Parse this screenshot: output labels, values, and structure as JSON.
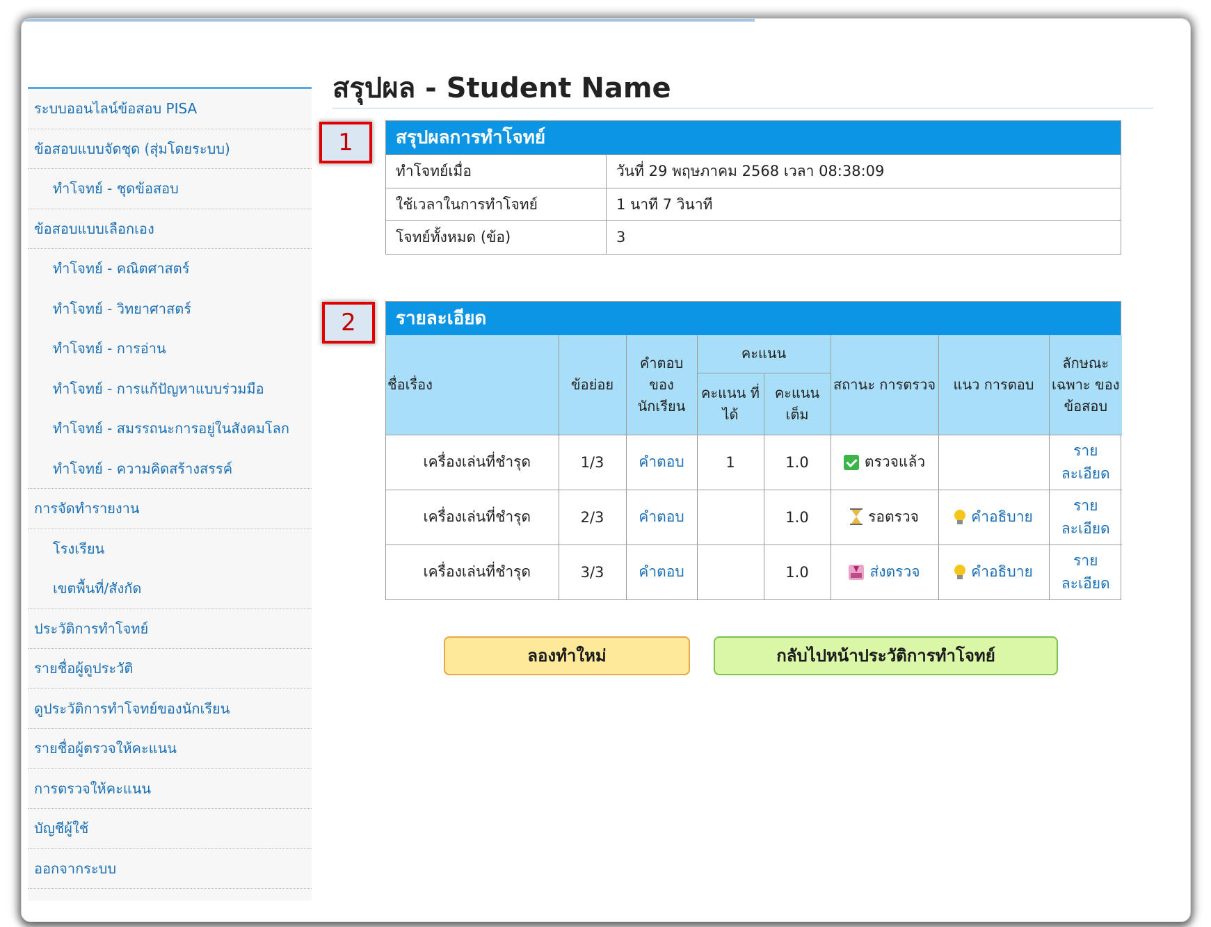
{
  "page": {
    "title": "สรุปผล - Student Name"
  },
  "sidebar": {
    "items": [
      {
        "label": "ระบบออนไลน์ข้อสอบ PISA",
        "level": 0
      },
      {
        "label": "ข้อสอบแบบจัดชุด (สุ่มโดยระบบ)",
        "level": 0
      },
      {
        "label": "ทำโจทย์ - ชุดข้อสอบ",
        "level": 1
      },
      {
        "label": "ข้อสอบแบบเลือกเอง",
        "level": 0
      },
      {
        "label": "ทำโจทย์ - คณิตศาสตร์",
        "level": 1
      },
      {
        "label": "ทำโจทย์ - วิทยาศาสตร์",
        "level": 1
      },
      {
        "label": "ทำโจทย์ - การอ่าน",
        "level": 1
      },
      {
        "label": "ทำโจทย์ - การแก้ปัญหาแบบร่วมมือ",
        "level": 1
      },
      {
        "label": "ทำโจทย์ - สมรรถนะการอยู่ในสังคมโลก",
        "level": 1
      },
      {
        "label": "ทำโจทย์ - ความคิดสร้างสรรค์",
        "level": 1
      },
      {
        "label": "การจัดทำรายงาน",
        "level": 0
      },
      {
        "label": "โรงเรียน",
        "level": 1
      },
      {
        "label": "เขตพื้นที่/สังกัด",
        "level": 1
      },
      {
        "label": "ประวัติการทำโจทย์",
        "level": 0
      },
      {
        "label": "รายชื่อผู้ดูประวัติ",
        "level": 0
      },
      {
        "label": "ดูประวัติการทำโจทย์ของนักเรียน",
        "level": 0
      },
      {
        "label": "รายชื่อผู้ตรวจให้คะแนน",
        "level": 0
      },
      {
        "label": "การตรวจให้คะแนน",
        "level": 0
      },
      {
        "label": "บัญชีผู้ใช้",
        "level": 0
      },
      {
        "label": "ออกจากระบบ",
        "level": 0
      }
    ]
  },
  "callouts": {
    "one": "1",
    "two": "2"
  },
  "summary": {
    "title": "สรุปผลการทำโจทย์",
    "rows": [
      {
        "label": "ทำโจทย์เมื่อ",
        "value": "วันที่ 29 พฤษภาคม 2568 เวลา 08:38:09"
      },
      {
        "label": "ใช้เวลาในการทำโจทย์",
        "value": "1 นาที 7 วินาที"
      },
      {
        "label": "โจทย์ทั้งหมด (ข้อ)",
        "value": "3"
      }
    ]
  },
  "detail": {
    "title": "รายละเอียด",
    "headers": {
      "topic": "ชื่อเรื่อง",
      "sub": "ข้อย่อย",
      "answer": "คำตอบ ของ นักเรียน",
      "score_group": "คะแนน",
      "score_got": "คะแนน ที่ได้",
      "score_full": "คะแนน เต็ม",
      "status": "สถานะ การตรวจ",
      "guide": "แนว การตอบ",
      "feature": "ลักษณะ เฉพาะ ของ ข้อสอบ"
    },
    "rows": [
      {
        "topic": "เครื่องเล่นที่ชำรุด",
        "sub": "1/3",
        "answer": "คำตอบ",
        "got": "1",
        "full": "1.0",
        "status": "ตรวจแล้ว",
        "status_icon": "check-icon",
        "status_link": false,
        "guide": "",
        "feature": "ราย ละเอียด"
      },
      {
        "topic": "เครื่องเล่นที่ชำรุด",
        "sub": "2/3",
        "answer": "คำตอบ",
        "got": "",
        "full": "1.0",
        "status": "รอตรวจ",
        "status_icon": "hourglass-icon",
        "status_link": false,
        "guide": "คำอธิบาย",
        "feature": "ราย ละเอียด"
      },
      {
        "topic": "เครื่องเล่นที่ชำรุด",
        "sub": "3/3",
        "answer": "คำตอบ",
        "got": "",
        "full": "1.0",
        "status": "ส่งตรวจ",
        "status_icon": "inbox-icon",
        "status_link": true,
        "guide": "คำอธิบาย",
        "feature": "ราย ละเอียด"
      }
    ]
  },
  "buttons": {
    "retry": "ลองทำใหม่",
    "back": "กลับไปหน้าประวัติการทำโจทย์"
  },
  "colors": {
    "header_blue": "#0b95e4",
    "table_head": "#a9def9",
    "link": "#1b6fb4",
    "retry_bg": "#fde999",
    "back_bg": "#d9f7a7",
    "callout_border": "#e00000"
  }
}
